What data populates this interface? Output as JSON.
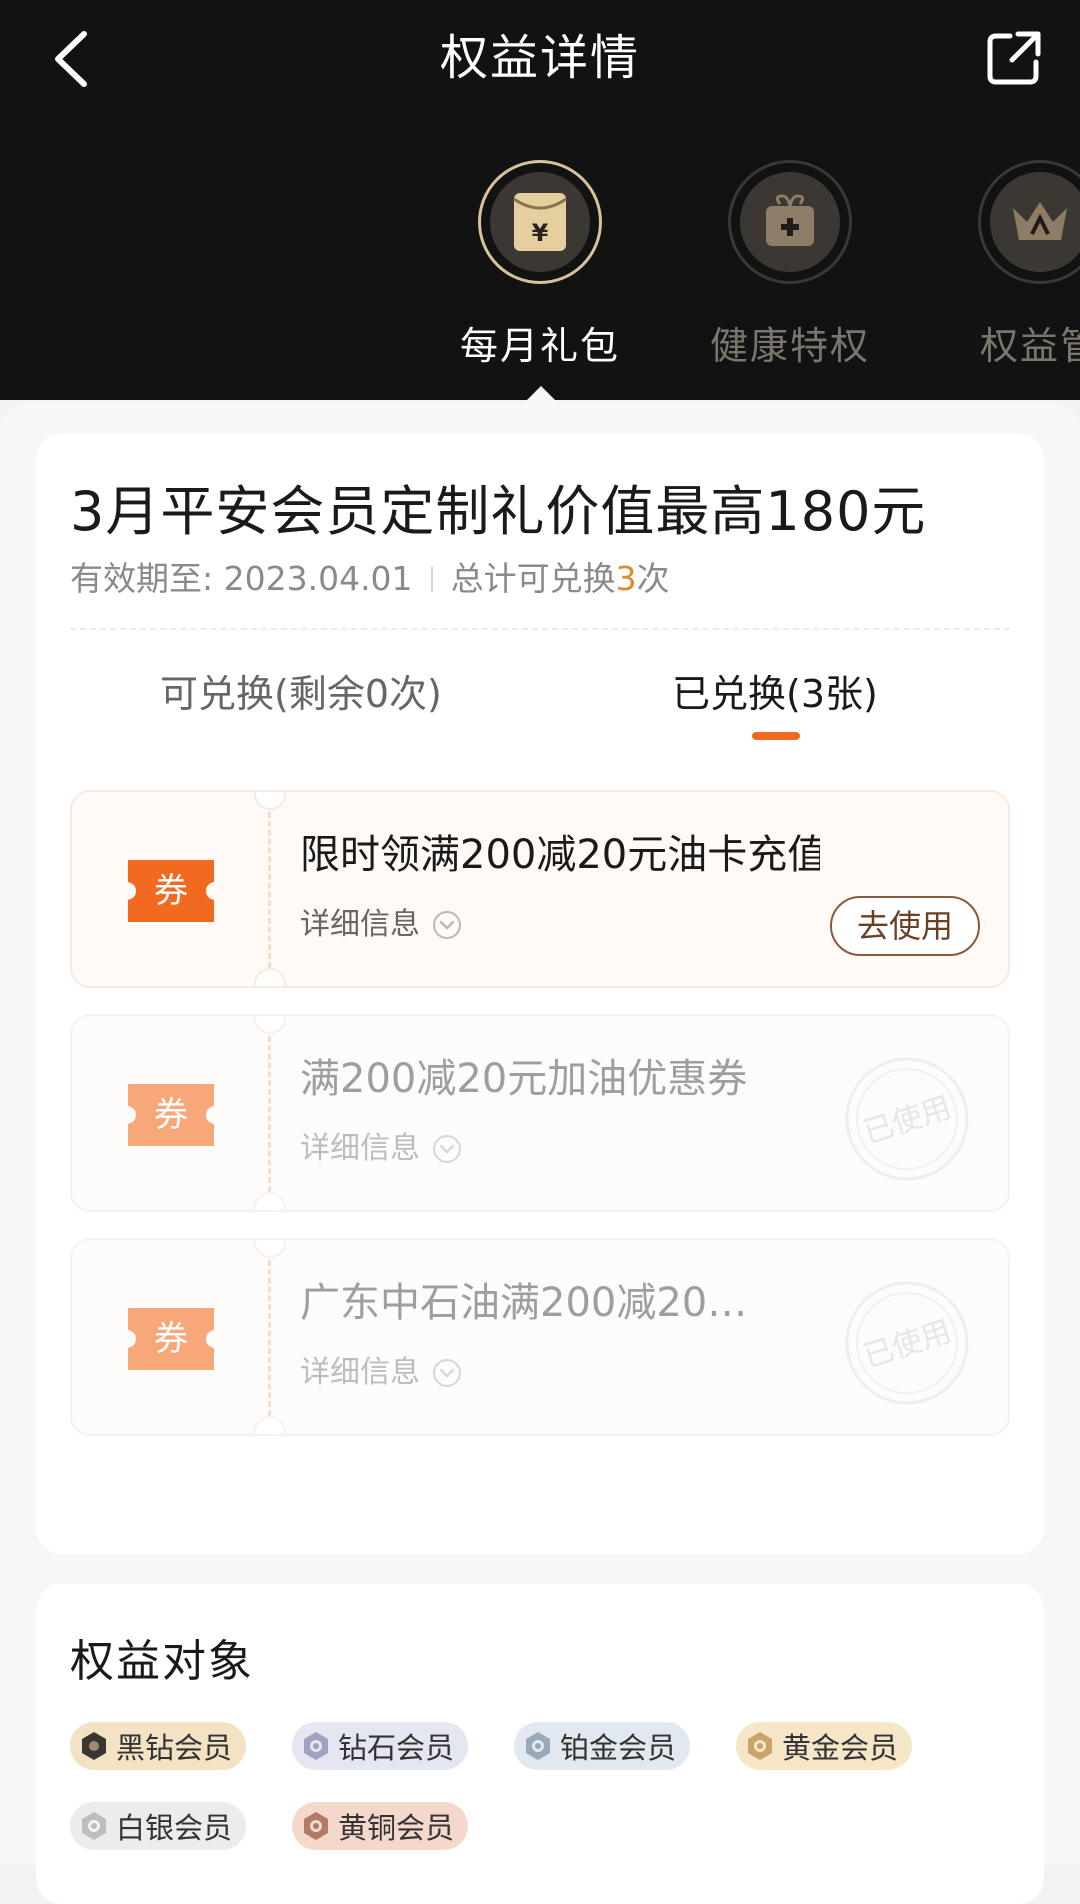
{
  "header": {
    "title": "权益详情"
  },
  "categories": [
    {
      "label": "每月礼包",
      "icon": "red-envelope-icon",
      "active": true
    },
    {
      "label": "健康特权",
      "icon": "gift-box-icon",
      "active": false
    },
    {
      "label": "权益管",
      "icon": "crown-icon",
      "active": false
    }
  ],
  "gift": {
    "title": "3月平安会员定制礼价值最高180元",
    "validity": "有效期至: 2023.04.01",
    "total_prefix": "总计可兑换",
    "total_count": "3",
    "total_suffix": "次"
  },
  "tabs": [
    {
      "label": "可兑换(剩余0次)",
      "active": false
    },
    {
      "label": "已兑换(3张)",
      "active": true
    }
  ],
  "coupons": [
    {
      "badge": "券",
      "name": "限时领满200减20元油卡充值券",
      "detail": "详细信息",
      "action": "去使用",
      "used": false
    },
    {
      "badge": "券",
      "name": "满200减20元加油优惠券",
      "detail": "详细信息",
      "stamp": "已使用",
      "used": true
    },
    {
      "badge": "券",
      "name": "广东中石油满200减20…",
      "detail": "详细信息",
      "stamp": "已使用",
      "used": true
    }
  ],
  "objects": {
    "title": "权益对象",
    "members": [
      {
        "label": "黑钻会员",
        "color": "#f4e2c4"
      },
      {
        "label": "钻石会员",
        "color": "#e4e6f1"
      },
      {
        "label": "铂金会员",
        "color": "#e2e8ef"
      },
      {
        "label": "黄金会员",
        "color": "#f6e6c8"
      },
      {
        "label": "白银会员",
        "color": "#ececec"
      },
      {
        "label": "黄铜会员",
        "color": "#f5d8cc"
      }
    ]
  },
  "colors": {
    "accent": "#ee6a21",
    "gold": "#d7c29b",
    "header_bg": "#121212"
  }
}
